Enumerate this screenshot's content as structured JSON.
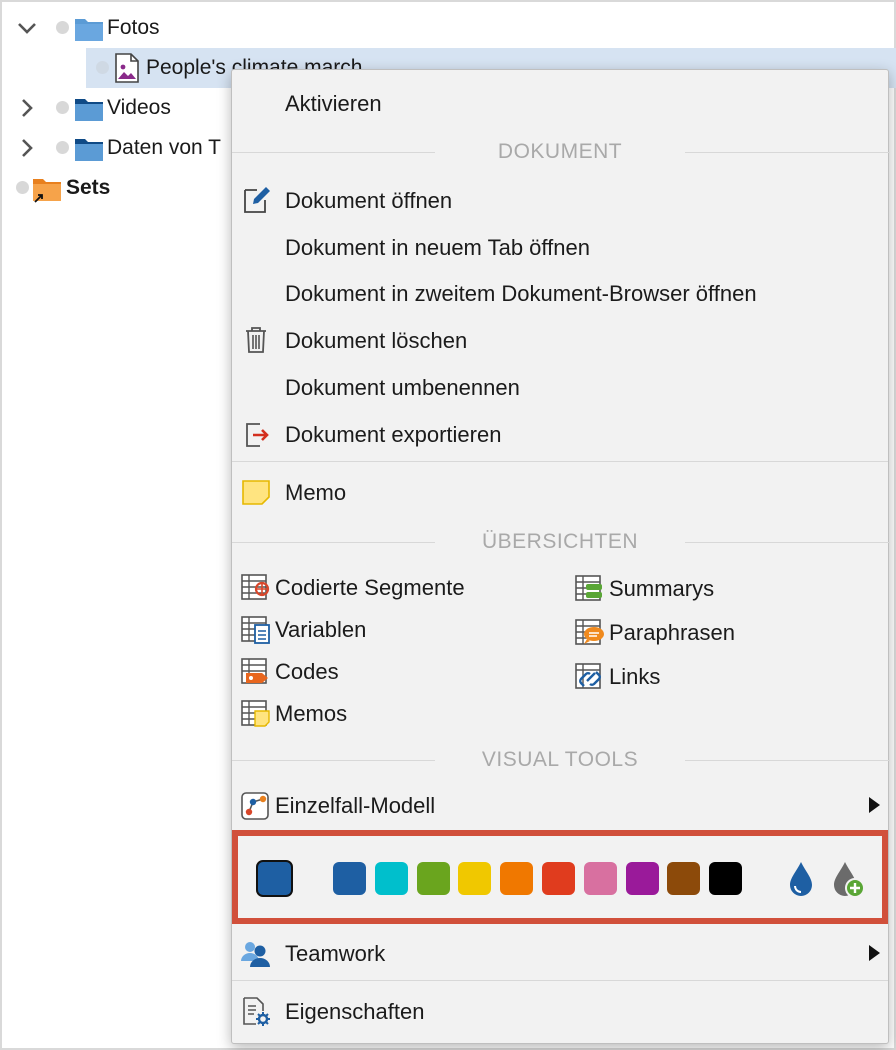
{
  "tree": {
    "items": [
      {
        "label": "Fotos",
        "expanded": true
      },
      {
        "label": "People's climate march",
        "selected": true
      },
      {
        "label": "Videos",
        "expanded": false
      },
      {
        "label": "Daten von T",
        "expanded": false
      },
      {
        "label": "Sets"
      }
    ]
  },
  "menu": {
    "activate": "Aktivieren",
    "section_document": "DOKUMENT",
    "open": "Dokument öffnen",
    "open_new_tab": "Dokument in neuem Tab öffnen",
    "open_second_browser": "Dokument in zweitem Dokument-Browser öffnen",
    "delete": "Dokument löschen",
    "rename": "Dokument umbenennen",
    "export": "Dokument exportieren",
    "memo": "Memo",
    "section_overviews": "ÜBERSICHTEN",
    "overviews": {
      "left": [
        "Codierte Segmente",
        "Variablen",
        "Codes",
        "Memos"
      ],
      "right": [
        "Summarys",
        "Paraphrasen",
        "Links"
      ]
    },
    "section_visual_tools": "VISUAL TOOLS",
    "single_case_model": "Einzelfall-Modell",
    "teamwork": "Teamwork",
    "properties": "Eigenschaften"
  },
  "colors": {
    "current": "#1e5fa3",
    "palette": [
      "#1e5fa3",
      "#00bfcc",
      "#6aa51e",
      "#f0c800",
      "#f07800",
      "#e03c1e",
      "#d870a0",
      "#9a1a9a",
      "#8c4a0a",
      "#000000"
    ],
    "highlight_border": "#d1503b"
  }
}
